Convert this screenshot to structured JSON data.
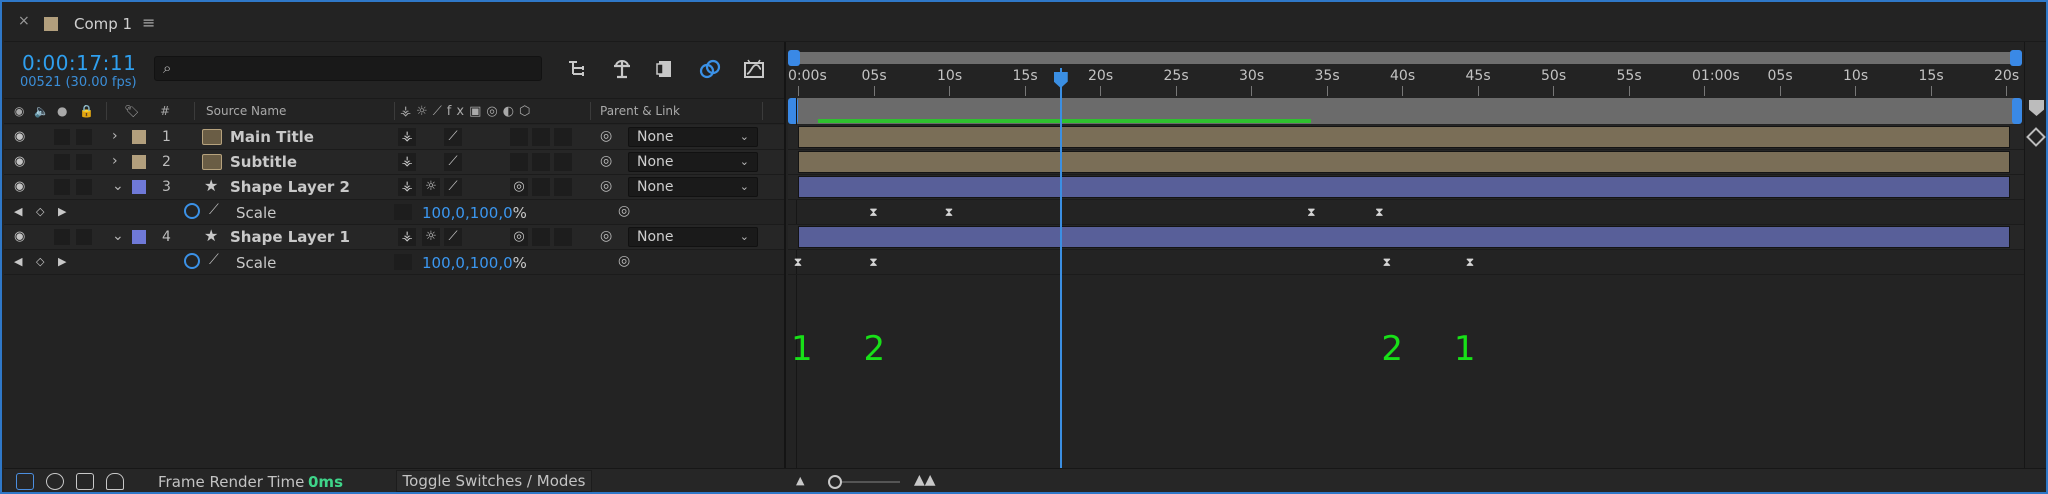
{
  "tab": {
    "title": "Comp 1",
    "close": "×",
    "menu": "≡",
    "swatch_color": "#b29f7d"
  },
  "timeline": {
    "timecode": "0:00:17:11",
    "frame_info": "00521 (30.00 fps)",
    "search_placeholder": "",
    "search_icon": "⌕",
    "tools": [
      "composition-mini-flowchart-icon",
      "draft-3d-icon",
      "hide-shy-layers-icon",
      "enable-frame-blending-icon",
      "graph-editor-icon"
    ]
  },
  "columns": {
    "hash": "#",
    "source_name": "Source Name",
    "parent_link": "Parent & Link"
  },
  "layers": [
    {
      "num": "1",
      "name": "Main Title",
      "type": "text",
      "label_color": "#b29f7d",
      "parent": "None",
      "twirl": "›",
      "bar_color": "tan"
    },
    {
      "num": "2",
      "name": "Subtitle",
      "type": "text",
      "label_color": "#b29f7d",
      "parent": "None",
      "twirl": "›",
      "bar_color": "tan"
    },
    {
      "num": "3",
      "name": "Shape Layer 2",
      "type": "shape",
      "label_color": "#6f79d8",
      "parent": "None",
      "twirl": "⌄",
      "bar_color": "blue"
    },
    {
      "num": "4",
      "name": "Shape Layer 1",
      "type": "shape",
      "label_color": "#6f79d8",
      "parent": "None",
      "twirl": "⌄",
      "bar_color": "blue"
    }
  ],
  "properties": [
    {
      "name": "Scale",
      "value": "100,0,100,0",
      "unit": "%",
      "keyframes_s": [
        5,
        10,
        34,
        38.5
      ]
    },
    {
      "name": "Scale",
      "value": "100,0,100,0",
      "unit": "%",
      "keyframes_s": [
        0,
        5,
        39,
        44.5
      ]
    }
  ],
  "ruler": {
    "labels": [
      "0:00s",
      "05s",
      "10s",
      "15s",
      "20s",
      "25s",
      "30s",
      "35s",
      "40s",
      "45s",
      "50s",
      "55s",
      "01:00s",
      "05s",
      "10s",
      "15s",
      "20s"
    ],
    "current_time_s": 17.4,
    "work_area_preview_end_s": 34
  },
  "annotations": [
    {
      "text": "1",
      "at_s": 0.2
    },
    {
      "text": "2",
      "at_s": 5
    },
    {
      "text": "2",
      "at_s": 39.3
    },
    {
      "text": "1",
      "at_s": 44.1
    }
  ],
  "bottom": {
    "frame_render_label": "Frame Render Time",
    "frame_render_value": "0ms",
    "toggle_label": "Toggle Switches / Modes"
  }
}
